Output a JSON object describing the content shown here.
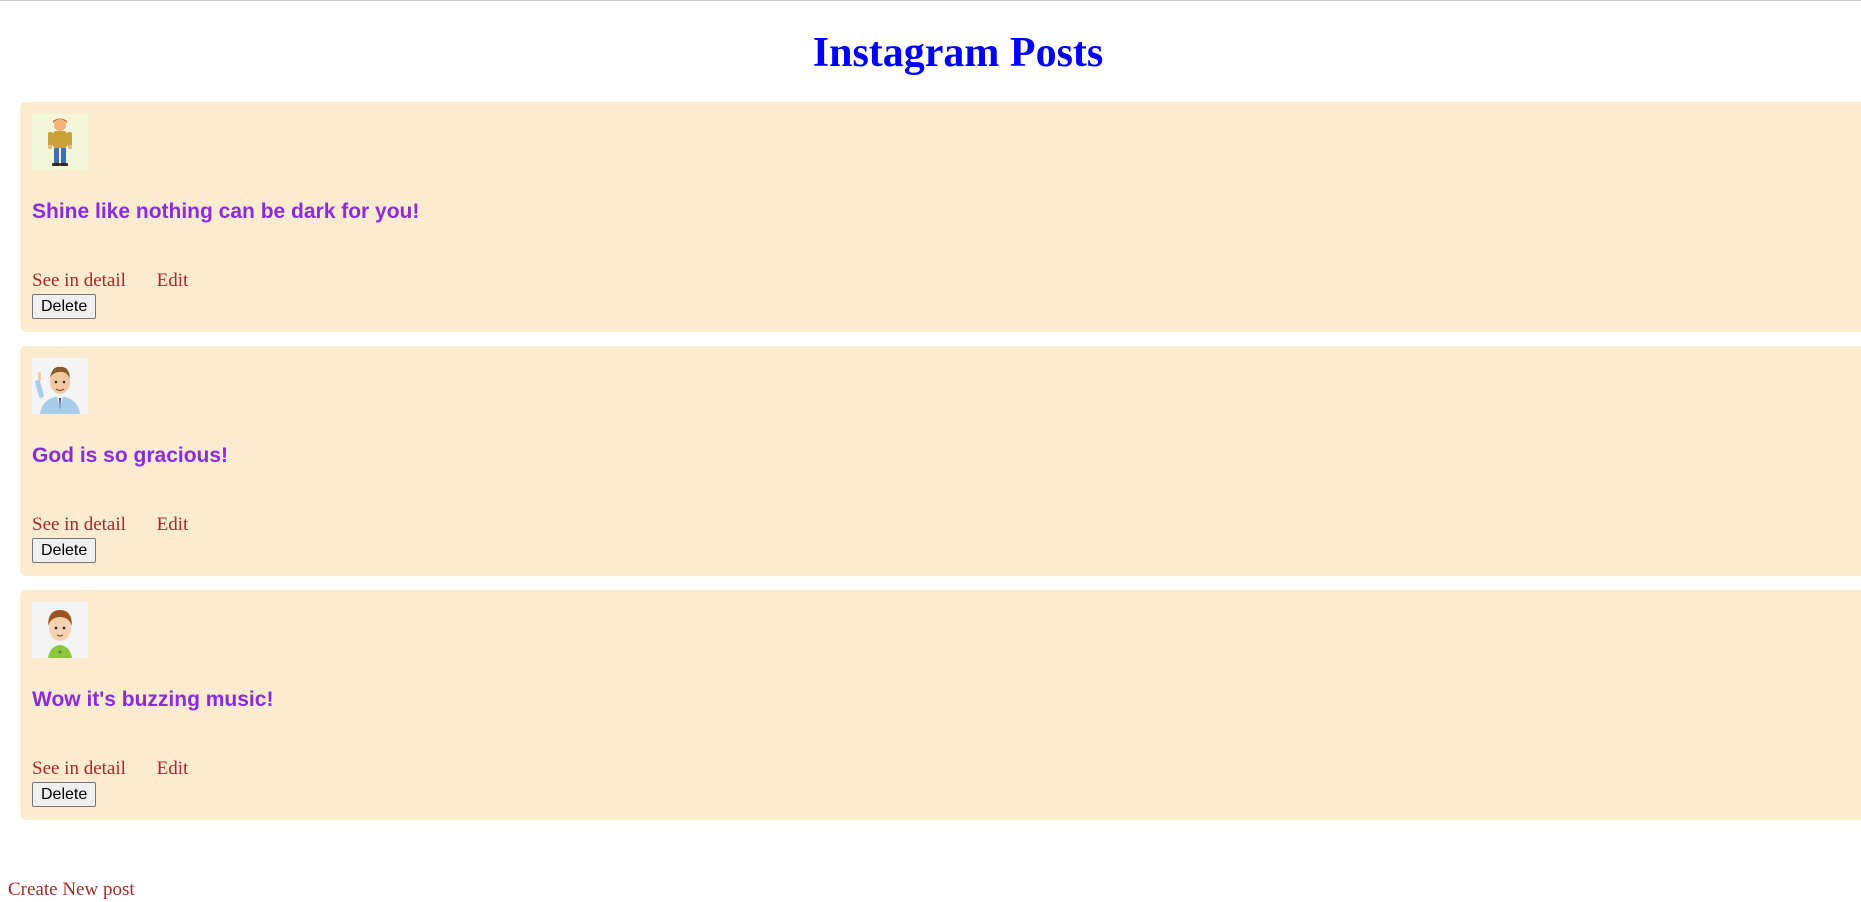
{
  "page": {
    "title": "Instagram Posts",
    "create_link": "Create New post"
  },
  "posts": [
    {
      "avatar_icon": "cartoon-boy-standing-avatar",
      "caption": "Shine like nothing can be dark for you!",
      "detail_link": "See in detail",
      "edit_link": "Edit",
      "delete_button": "Delete"
    },
    {
      "avatar_icon": "cartoon-man-pointing-avatar",
      "caption": "God is so gracious!",
      "detail_link": "See in detail",
      "edit_link": "Edit",
      "delete_button": "Delete"
    },
    {
      "avatar_icon": "cartoon-boy-green-shirt-avatar",
      "caption": "Wow it's buzzing music!",
      "detail_link": "See in detail",
      "edit_link": "Edit",
      "delete_button": "Delete"
    }
  ],
  "colors": {
    "title": "#0000ff",
    "card_background": "#fdebd0",
    "caption": "#8a2be2",
    "link": "#a52a2a"
  }
}
